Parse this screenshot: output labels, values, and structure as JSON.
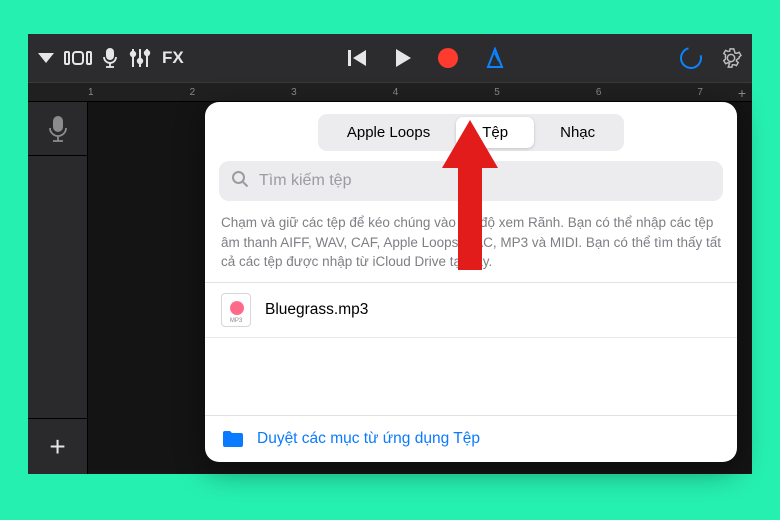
{
  "toolbar": {
    "fx_label": "FX"
  },
  "ruler": {
    "marks": [
      "1",
      "2",
      "3",
      "4",
      "5",
      "6",
      "7"
    ]
  },
  "panel": {
    "tabs": [
      {
        "label": "Apple Loops",
        "active": false
      },
      {
        "label": "Tệp",
        "active": true
      },
      {
        "label": "Nhạc",
        "active": false
      }
    ],
    "search_placeholder": "Tìm kiếm tệp",
    "help_text": "Chạm và giữ các tệp để kéo chúng vào Bộ độ xem Rãnh. Bạn có thể nhập các tệp âm thanh AIFF, WAV, CAF, Apple Loops, AAC, MP3 và MIDI. Bạn có thể tìm thấy tất cả các tệp được nhập từ iCloud Drive tại đây.",
    "files": [
      {
        "name": "Bluegrass.mp3",
        "badge": "MP3"
      }
    ],
    "browse_label": "Duyệt các mục từ ứng dụng Tệp"
  }
}
